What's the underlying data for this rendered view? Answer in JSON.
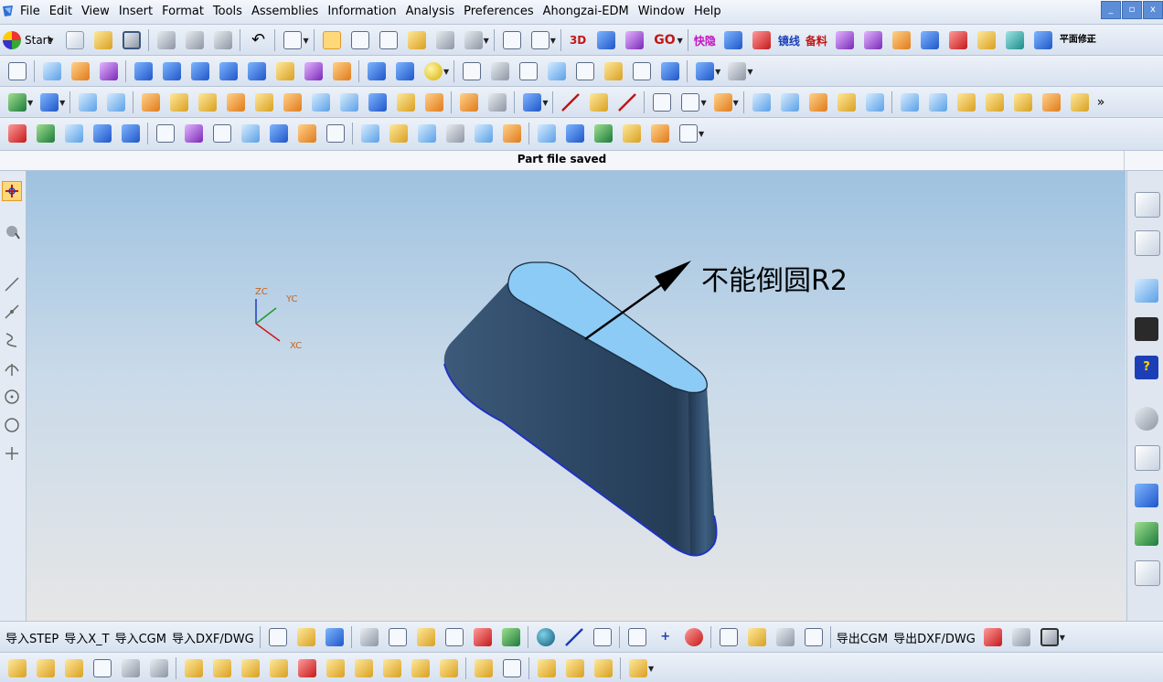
{
  "menu": [
    "File",
    "Edit",
    "View",
    "Insert",
    "Format",
    "Tools",
    "Assemblies",
    "Information",
    "Analysis",
    "Preferences",
    "Ahongzai-EDM",
    "Window",
    "Help"
  ],
  "window_controls": [
    "_",
    "▫",
    "x"
  ],
  "toolbar1": {
    "start_label": "Start",
    "go_label": "GO",
    "label_3d": "3D",
    "kuaisu": "快隐",
    "jingxian": "镜线",
    "beiliao": "备料",
    "pingmian": "平面修正"
  },
  "status": {
    "message": "Part file saved"
  },
  "viewport": {
    "annotation": "不能倒圆R2",
    "axes": {
      "z": "ZC",
      "y": "YC",
      "x": "XC"
    }
  },
  "bottom_toolbar": {
    "import_step": "导入STEP",
    "import_xt": "导入X_T",
    "import_cgm": "导入CGM",
    "import_dxf": "导入DXF/DWG",
    "export_cgm": "导出CGM",
    "export_dxf": "导出DXF/DWG"
  },
  "colors": {
    "viewport_top": "#9ec2e0",
    "viewport_bottom": "#e6e6e6",
    "part_body": "#2f4a68",
    "part_top_face": "#8ccbf6",
    "active_tool": "#ffd87a"
  }
}
